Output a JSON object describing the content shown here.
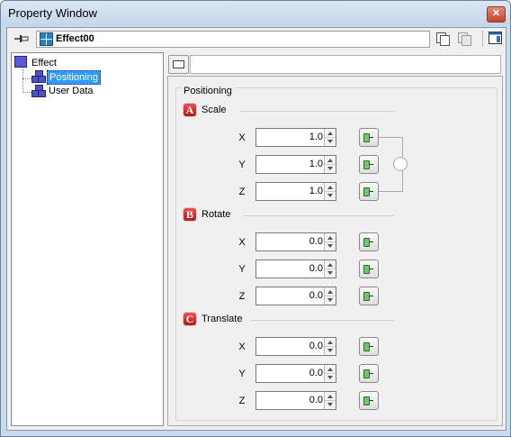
{
  "window": {
    "title": "Property Window",
    "close_label": "✕"
  },
  "toolbar": {
    "effect_name": "Effect00"
  },
  "tree": {
    "root": "Effect",
    "children": [
      "Positioning",
      "User Data"
    ],
    "selected": "Positioning"
  },
  "panel": {
    "group_title": "Positioning",
    "sections": [
      {
        "badge": "A",
        "label": "Scale",
        "axes": [
          "X",
          "Y",
          "Z"
        ],
        "values": [
          "1.0",
          "1.0",
          "1.0"
        ]
      },
      {
        "badge": "B",
        "label": "Rotate",
        "axes": [
          "X",
          "Y",
          "Z"
        ],
        "values": [
          "0.0",
          "0.0",
          "0.0"
        ]
      },
      {
        "badge": "C",
        "label": "Translate",
        "axes": [
          "X",
          "Y",
          "Z"
        ],
        "values": [
          "0.0",
          "0.0",
          "0.0"
        ]
      }
    ]
  },
  "icons": {
    "pin": "pin-icon",
    "effect": "effect-node-icon",
    "copy": "copy-icon",
    "paste": "paste-icon",
    "window_menu": "window-menu-icon",
    "keyframe": "keyframe-icon",
    "link": "scale-link-icon"
  },
  "colors": {
    "selection": "#3399ff",
    "badge": "#c62020",
    "titlebar": "#c9dcec"
  }
}
